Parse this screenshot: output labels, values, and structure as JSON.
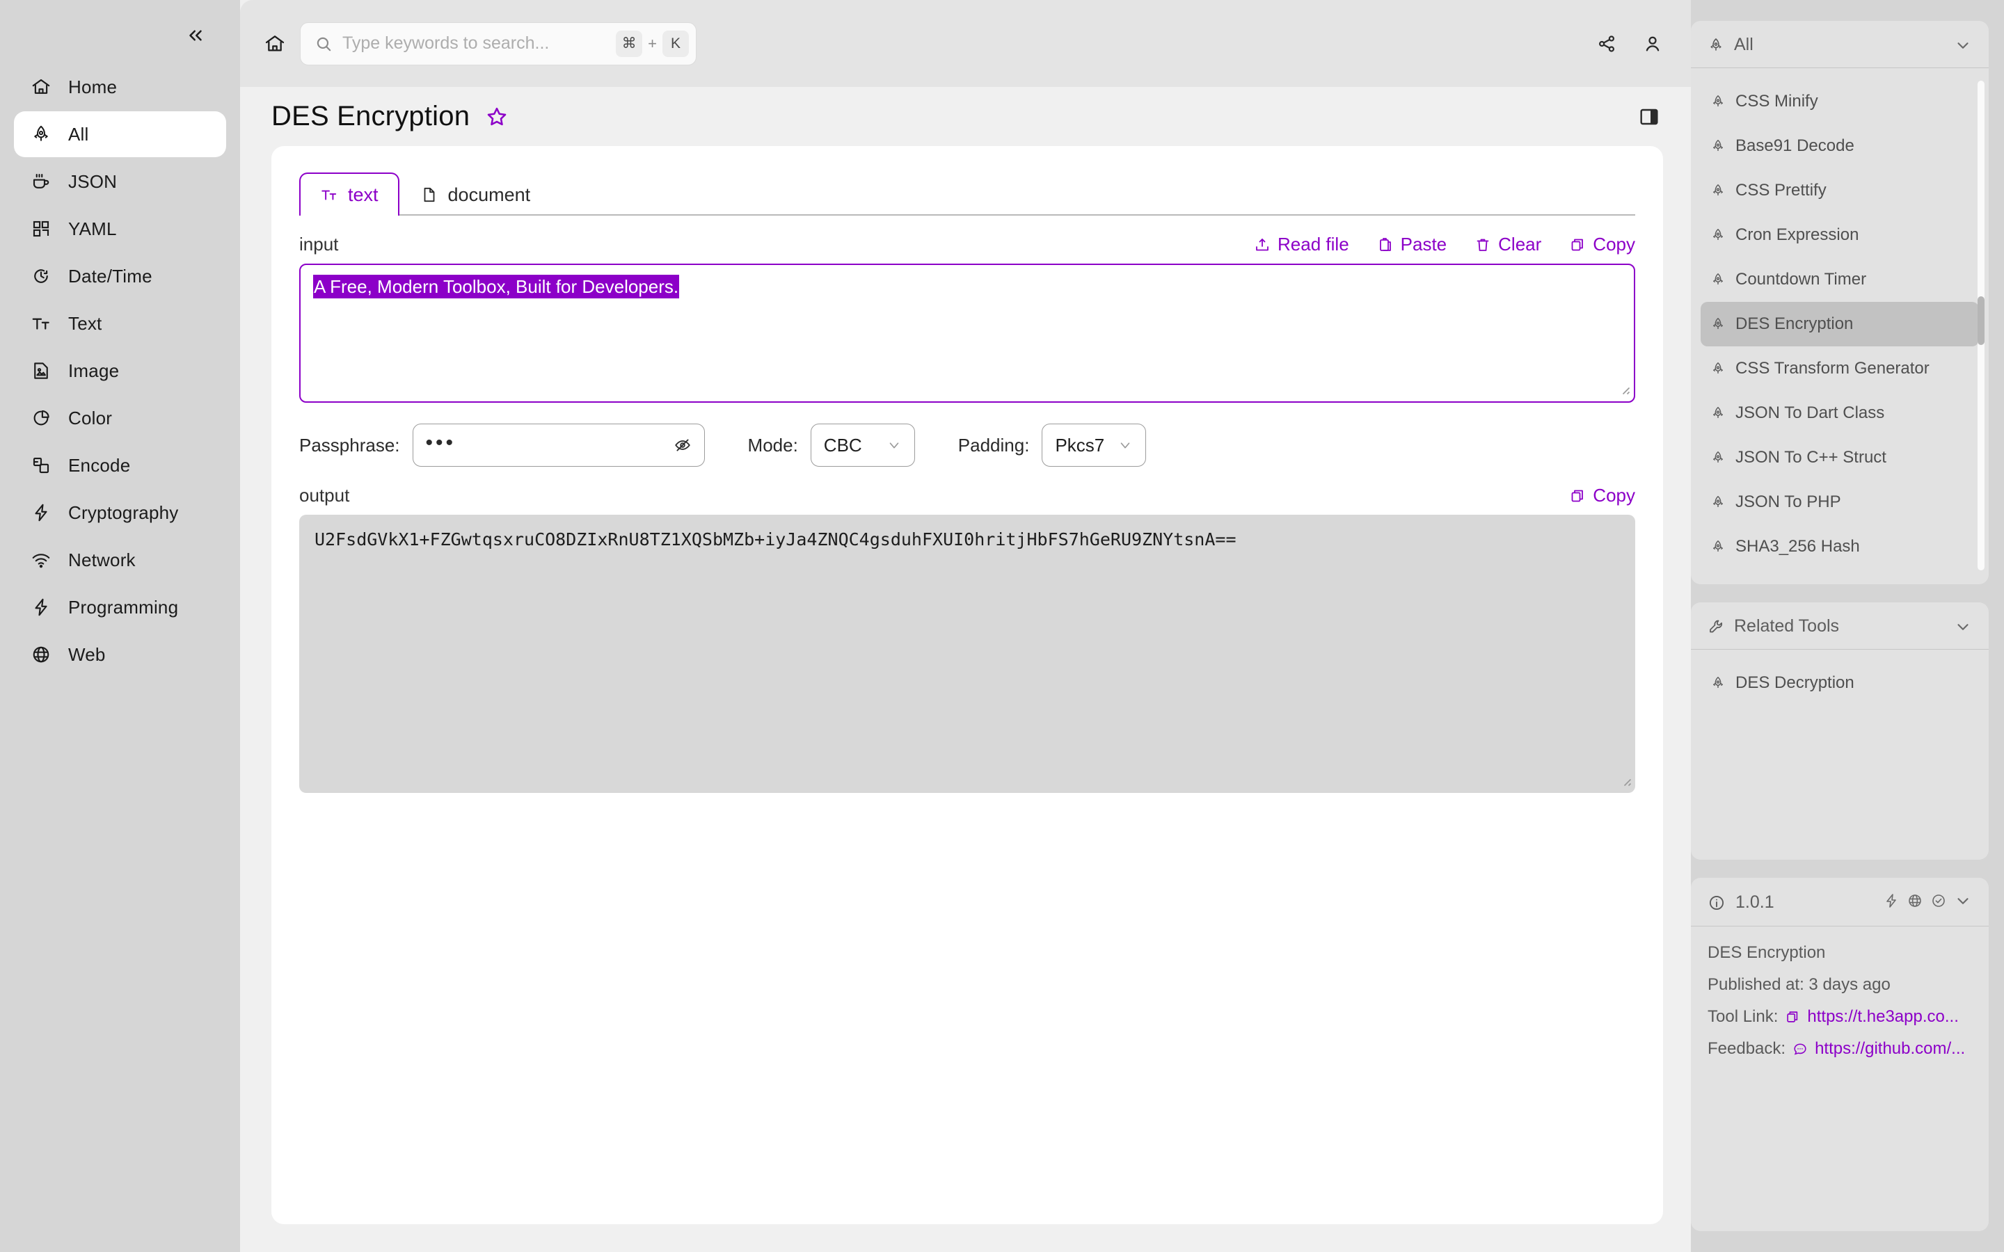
{
  "sidebar": {
    "collapse_label": "«",
    "items": [
      {
        "label": "Home",
        "icon": "home-icon",
        "active": false
      },
      {
        "label": "All",
        "icon": "rocket-icon",
        "active": true
      },
      {
        "label": "JSON",
        "icon": "coffee-icon",
        "active": false
      },
      {
        "label": "YAML",
        "icon": "grid-icon",
        "active": false
      },
      {
        "label": "Date/Time",
        "icon": "clock-icon",
        "active": false
      },
      {
        "label": "Text",
        "icon": "text-format-icon",
        "active": false
      },
      {
        "label": "Image",
        "icon": "image-icon",
        "active": false
      },
      {
        "label": "Color",
        "icon": "pie-chart-icon",
        "active": false
      },
      {
        "label": "Encode",
        "icon": "layers-icon",
        "active": false
      },
      {
        "label": "Cryptography",
        "icon": "lightning-icon",
        "active": false
      },
      {
        "label": "Network",
        "icon": "wifi-icon",
        "active": false
      },
      {
        "label": "Programming",
        "icon": "lightning-icon",
        "active": false
      },
      {
        "label": "Web",
        "icon": "globe-icon",
        "active": false
      }
    ]
  },
  "topbar": {
    "home_icon": "home-icon",
    "search": {
      "placeholder": "Type keywords to search...",
      "value": "",
      "icon": "search-icon",
      "shortcut_key": "⌘",
      "shortcut_plus": "+",
      "shortcut_letter": "K"
    },
    "share_icon": "share-icon",
    "account_icon": "user-icon"
  },
  "page": {
    "title": "DES Encryption",
    "star_icon": "star-icon",
    "panel_toggle_icon": "panel-right-icon"
  },
  "tool": {
    "tabs": [
      {
        "label": "text",
        "icon": "text-format-icon",
        "active": true
      },
      {
        "label": "document",
        "icon": "document-icon",
        "active": false
      }
    ],
    "input": {
      "label": "input",
      "value": "A Free, Modern Toolbox, Built for Developers.",
      "actions": [
        {
          "label": "Read file",
          "icon": "upload-icon"
        },
        {
          "label": "Paste",
          "icon": "clipboard-icon"
        },
        {
          "label": "Clear",
          "icon": "trash-icon"
        },
        {
          "label": "Copy",
          "icon": "copy-icon"
        }
      ]
    },
    "options": {
      "passphrase_label": "Passphrase:",
      "passphrase_value": "•••",
      "passphrase_toggle_icon": "eye-off-icon",
      "mode_label": "Mode:",
      "mode_value": "CBC",
      "padding_label": "Padding:",
      "padding_value": "Pkcs7"
    },
    "output": {
      "label": "output",
      "copy_label": "Copy",
      "copy_icon": "copy-icon",
      "value": "U2FsdGVkX1+FZGwtqsxruCO8DZIxRnU8TZ1XQSbMZb+iyJa4ZNQC4gsduhFXUI0hritjHbFS7hGeRU9ZNYtsnA=="
    }
  },
  "right_panel": {
    "tools_card": {
      "title": "All",
      "icon": "rocket-icon",
      "chevron_icon": "chevron-down-icon",
      "items": [
        {
          "label": "CSS Minify",
          "active": false
        },
        {
          "label": "Base91 Decode",
          "active": false
        },
        {
          "label": "CSS Prettify",
          "active": false
        },
        {
          "label": "Cron Expression",
          "active": false
        },
        {
          "label": "Countdown Timer",
          "active": false
        },
        {
          "label": "DES Encryption",
          "active": true
        },
        {
          "label": "CSS Transform Generator",
          "active": false
        },
        {
          "label": "JSON To Dart Class",
          "active": false
        },
        {
          "label": "JSON To C++ Struct",
          "active": false
        },
        {
          "label": "JSON To PHP",
          "active": false
        },
        {
          "label": "SHA3_256 Hash",
          "active": false
        }
      ]
    },
    "related_card": {
      "title": "Related Tools",
      "icon": "wrench-icon",
      "chevron_icon": "chevron-down-icon",
      "items": [
        {
          "label": "DES Decryption",
          "active": false
        }
      ]
    },
    "info_card": {
      "version": "1.0.1",
      "info_icon": "info-icon",
      "icons": [
        "lightning-icon",
        "globe-icon",
        "check-circle-icon",
        "chevron-down-icon"
      ],
      "tool_name": "DES Encryption",
      "published": "Published at: 3 days ago",
      "tool_link_label": "Tool Link:",
      "tool_link_value": "https://t.he3app.co...",
      "tool_link_icon": "copy-icon",
      "feedback_label": "Feedback:",
      "feedback_value": "https://github.com/...",
      "feedback_icon": "message-icon"
    }
  },
  "colors": {
    "accent": "#8c00c8",
    "sidebar_bg": "#d6d6d6",
    "panel_bg": "#e2e2e2",
    "output_bg": "#d8d8d8"
  }
}
